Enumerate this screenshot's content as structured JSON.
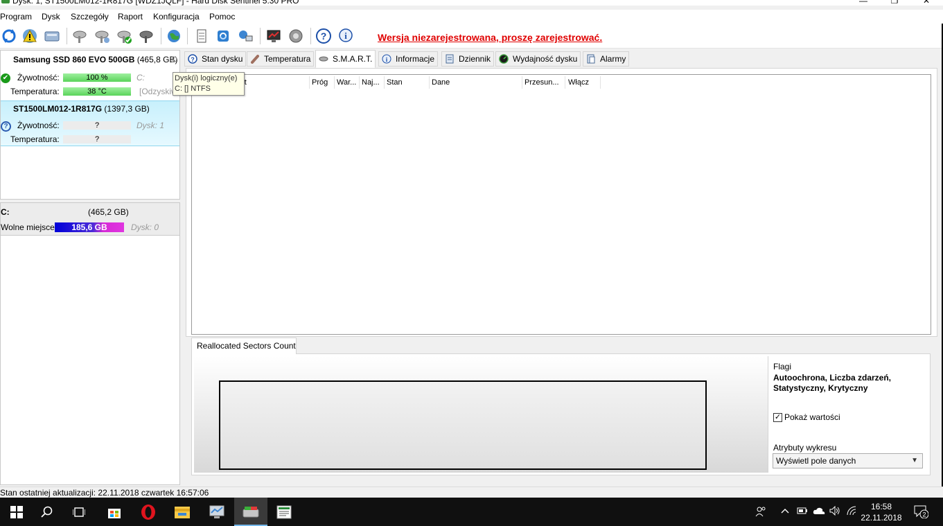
{
  "window": {
    "title": "Dysk: 1, ST1500LM012-1R817G [WDZ1JQLF]  -  Hard Disk Sentinel 5.30 PRO",
    "minimize": "—",
    "maximize": "❐",
    "close": "✕"
  },
  "menu": [
    "Program",
    "Dysk",
    "Szczegóły",
    "Raport",
    "Konfiguracja",
    "Pomoc"
  ],
  "toolbar": {
    "register_link": "Wersja niezarejestrowana, proszę zarejestrować."
  },
  "disks": [
    {
      "name": "Samsung SSD 860 EVO 500GB",
      "size": "(465,8 GB)",
      "extra": "D",
      "health_label": "Żywotność:",
      "health_value": "100 %",
      "health_note": "C:",
      "temp_label": "Temperatura:",
      "temp_value": "38 °C",
      "temp_note": "[Odzyskiw"
    },
    {
      "name": "ST1500LM012-1R817G",
      "size": "(1397,3 GB)",
      "health_label": "Żywotność:",
      "health_value": "?",
      "health_note": "Dysk: 1",
      "temp_label": "Temperatura:",
      "temp_value": "?"
    }
  ],
  "partition": {
    "drive": "C:",
    "size": "(465,2 GB)",
    "free_label": "Wolne miejsce",
    "free_value": "185,6 GB",
    "disk_note": "Dysk: 0",
    "free_fraction": 0.6
  },
  "tooltip": {
    "line1": "Dysk(i) logiczny(e)",
    "line2": "C: [] NTFS"
  },
  "tabs": [
    {
      "label": "Stan dysku",
      "icon": "help-circle-icon"
    },
    {
      "label": "Temperatura",
      "icon": "thermometer-icon"
    },
    {
      "label": "S.M.A.R.T.",
      "icon": "disk-icon",
      "active": true
    },
    {
      "label": "Informacje",
      "icon": "info-icon"
    },
    {
      "label": "Dziennik",
      "icon": "log-icon"
    },
    {
      "label": "Wydajność dysku",
      "icon": "gauge-icon"
    },
    {
      "label": "Alarmy",
      "icon": "alarm-icon"
    }
  ],
  "smart_columns": [
    "Atrybut",
    "Próg",
    "War...",
    "Naj...",
    "Stan",
    "Dane",
    "Przesun...",
    "Włącz"
  ],
  "chart": {
    "tab_label": "Reallocated Sectors Count",
    "flags_label": "Flagi",
    "flags_value": "Autoochrona, Liczba zdarzeń, Statystyczny, Krytyczny",
    "show_values_label": "Pokaż wartości",
    "show_values_checked": true,
    "attributes_label": "Atrybuty wykresu",
    "attributes_value": "Wyświetl pole danych"
  },
  "status": {
    "text": "Stan ostatniej aktualizacji: 22.11.2018 czwartek 16:57:06"
  },
  "taskbar": {
    "time": "16:58",
    "date": "22.11.2018",
    "notifications": "2"
  }
}
